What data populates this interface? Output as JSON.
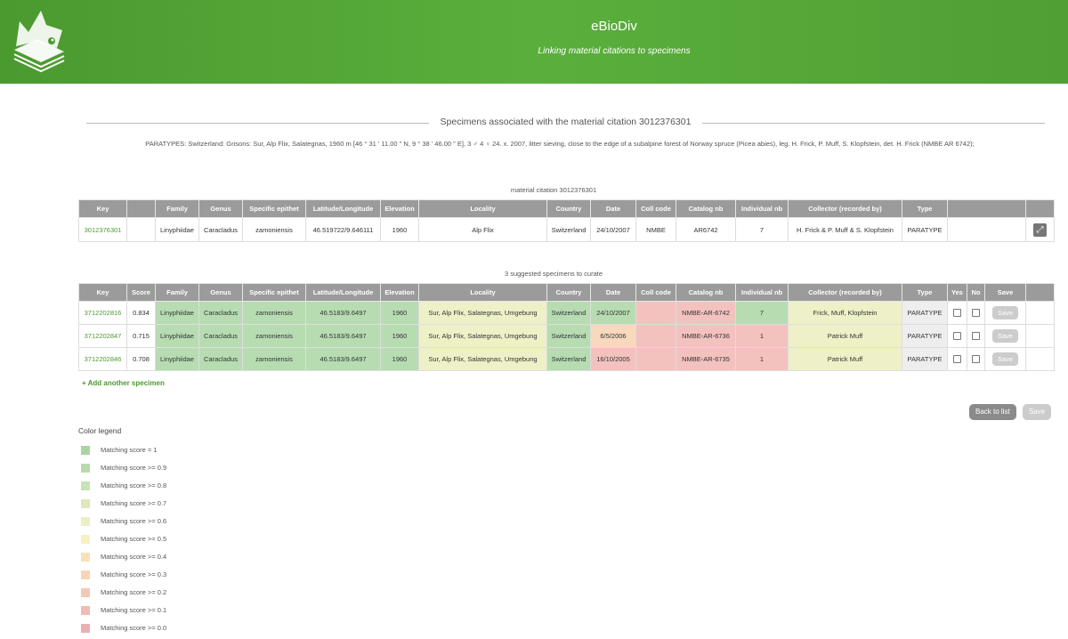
{
  "header": {
    "title": "eBioDiv",
    "subtitle": "Linking material citations to specimens"
  },
  "section": {
    "title": "Specimens associated with the material citation 3012376301",
    "description": "PARATYPES: Switzerland: Grisons: Sur, Alp Flix, Salategnas, 1960 m [46 ° 31 ' 11.00 \" N, 9 ° 38 ' 46.00 \" E], 3 ♂ 4 ♀ 24. x. 2007, litter sieving, close to the edge of a subalpine forest of Norway spruce (Picea abies), leg. H. Frick, P. Muff, S. Klopfstein, det. H. Frick (NMBE AR 6742);"
  },
  "citation_table": {
    "caption": "material citation 3012376301",
    "headers": [
      "Key",
      "",
      "Family",
      "Genus",
      "Specific epithet",
      "Latitude/Longitude",
      "Elevation",
      "Locality",
      "Country",
      "Date",
      "Coll code",
      "Catalog nb",
      "Individual nb",
      "Collector (recorded by)",
      "Type",
      "",
      ""
    ],
    "row": {
      "key": "3012376301",
      "score": "",
      "family": "Linyphiidae",
      "genus": "Caracladus",
      "epithet": "zamoniensis",
      "latlon": "46.519722/9.646111",
      "elevation": "1960",
      "locality": "Alp Flix",
      "country": "Switzerland",
      "date": "24/10/2007",
      "collcode": "NMBE",
      "catalog": "AR6742",
      "individual": "7",
      "collector": "H. Frick & P. Muff & S. Klopfstein",
      "type": "PARATYPE",
      "expand_icon": "expand-icon"
    }
  },
  "suggested_table": {
    "caption": "3 suggested specimens to curate",
    "headers": [
      "Key",
      "Score",
      "Family",
      "Genus",
      "Specific epithet",
      "Latitude/Longitude",
      "Elevation",
      "Locality",
      "Country",
      "Date",
      "Coll code",
      "Catalog nb",
      "Individual nb",
      "Collector (recorded by)",
      "Type",
      "Yes",
      "No",
      "Save",
      ""
    ],
    "save_label": "Save",
    "rows": [
      {
        "key": "3712202816",
        "score": "0.834",
        "family": "Linyphiidae",
        "genus": "Caracladus",
        "epithet": "zamoniensis",
        "latlon": "46.5183/9.6497",
        "elevation": "1960",
        "locality": "Sur, Alp Flix, Salategnas, Umgebung",
        "country": "Switzerland",
        "date": "24/10/2007",
        "collcode": "",
        "catalog": "NMBE-AR-6742",
        "individual": "7",
        "collector": "Frick, Muff, Klopfstein",
        "type": "PARATYPE"
      },
      {
        "key": "3712202847",
        "score": "0.715",
        "family": "Linyphiidae",
        "genus": "Caracladus",
        "epithet": "zamoniensis",
        "latlon": "46.5183/9.6497",
        "elevation": "1960",
        "locality": "Sur, Alp Flix, Salategnas, Umgebung",
        "country": "Switzerland",
        "date": "6/5/2006",
        "collcode": "",
        "catalog": "NMBE-AR-6736",
        "individual": "1",
        "collector": "Patrick Muff",
        "type": "PARATYPE"
      },
      {
        "key": "3712202846",
        "score": "0.708",
        "family": "Linyphiidae",
        "genus": "Caracladus",
        "epithet": "zamoniensis",
        "latlon": "46.5183/9.6497",
        "elevation": "1960",
        "locality": "Sur, Alp Flix, Salategnas, Umgebung",
        "country": "Switzerland",
        "date": "16/10/2005",
        "collcode": "",
        "catalog": "NMBE-AR-6735",
        "individual": "1",
        "collector": "Patrick Muff",
        "type": "PARATYPE"
      }
    ]
  },
  "actions": {
    "add_specimen": "+ Add another specimen",
    "back_to_list": "Back to list",
    "save": "Save"
  },
  "legend": {
    "title": "Color legend",
    "items": [
      {
        "label": "Matching score = 1",
        "color": "#a9d5a3"
      },
      {
        "label": "Matching score >= 0.9",
        "color": "#b8dbae"
      },
      {
        "label": "Matching score >= 0.8",
        "color": "#c8e3b5"
      },
      {
        "label": "Matching score >= 0.7",
        "color": "#dde8bb"
      },
      {
        "label": "Matching score >= 0.6",
        "color": "#ecefc4"
      },
      {
        "label": "Matching score >= 0.5",
        "color": "#f7f0c2"
      },
      {
        "label": "Matching score >= 0.4",
        "color": "#f8e2b8"
      },
      {
        "label": "Matching score >= 0.3",
        "color": "#f6d6b8"
      },
      {
        "label": "Matching score >= 0.2",
        "color": "#f2c9b7"
      },
      {
        "label": "Matching score >= 0.1",
        "color": "#efbcb4"
      },
      {
        "label": "Matching score >= 0.0",
        "color": "#ebb1b0"
      }
    ]
  },
  "cell_colors": {
    "green": "#b7dcb2",
    "yellow": "#eef1c7",
    "orange": "#f8d9bd",
    "red": "#f3c2bf",
    "grey": "#eeeeee",
    "white": "#ffffff"
  },
  "row_colors": [
    {
      "score": "white",
      "family": "green",
      "genus": "green",
      "epithet": "green",
      "latlon": "green",
      "elevation": "green",
      "locality": "yellow",
      "country": "green",
      "date": "green",
      "collcode": "red",
      "catalog": "red",
      "individual": "green",
      "collector": "yellow",
      "type": "grey"
    },
    {
      "score": "white",
      "family": "green",
      "genus": "green",
      "epithet": "green",
      "latlon": "green",
      "elevation": "green",
      "locality": "yellow",
      "country": "green",
      "date": "orange",
      "collcode": "red",
      "catalog": "red",
      "individual": "red",
      "collector": "yellow",
      "type": "grey"
    },
    {
      "score": "white",
      "family": "green",
      "genus": "green",
      "epithet": "green",
      "latlon": "green",
      "elevation": "green",
      "locality": "yellow",
      "country": "green",
      "date": "red",
      "collcode": "red",
      "catalog": "red",
      "individual": "red",
      "collector": "yellow",
      "type": "grey"
    }
  ]
}
